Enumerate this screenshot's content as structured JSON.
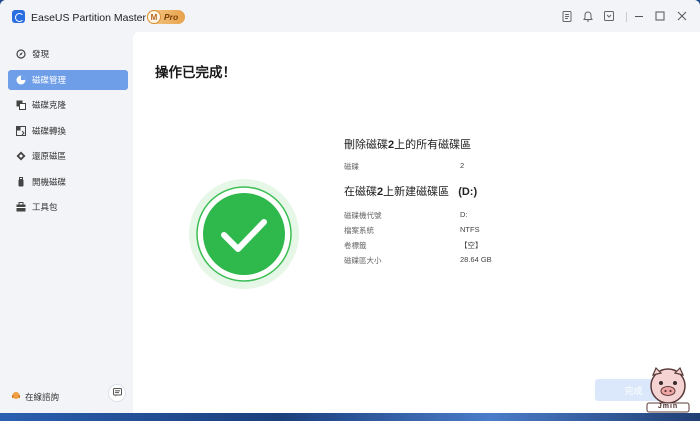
{
  "window": {
    "app_title": "EaseUS Partition Master 專業版",
    "badge_letter": "M",
    "badge_text": "Pro",
    "controls": [
      "notes-icon",
      "bell-icon",
      "dropdown-menu-icon",
      "minimize-icon",
      "maximize-icon",
      "close-icon"
    ]
  },
  "sidebar": {
    "items": [
      {
        "label": "發現",
        "icon": "discover-icon",
        "active": false
      },
      {
        "label": "磁碟管理",
        "icon": "disk-management-icon",
        "active": true
      },
      {
        "label": "磁碟克隆",
        "icon": "disk-clone-icon",
        "active": false
      },
      {
        "label": "磁碟轉換",
        "icon": "disk-convert-icon",
        "active": false
      },
      {
        "label": "還原磁區",
        "icon": "partition-recovery-icon",
        "active": false
      },
      {
        "label": "開機磁碟",
        "icon": "bootable-disk-icon",
        "active": false
      },
      {
        "label": "工具包",
        "icon": "toolkit-icon",
        "active": false
      }
    ],
    "help_label": "在線諮詢",
    "help_icon": "chat-support-icon",
    "feedback_icon": "feedback-icon"
  },
  "main": {
    "title": "操作已完成！",
    "success_icon": "checkmark-circle-icon",
    "operations": [
      {
        "title_prefix": "刪除磁碟",
        "title_bold": "2",
        "title_suffix": "上的所有磁碟區",
        "properties": [
          {
            "label": "磁碟",
            "value": "2"
          }
        ]
      },
      {
        "title_prefix": "在磁碟",
        "title_bold": "2",
        "title_suffix": "上新建磁碟區",
        "title_extra": "(D:)",
        "properties": [
          {
            "label": "磁碟機代號",
            "value": "D:"
          },
          {
            "label": "檔案系統",
            "value": "NTFS"
          },
          {
            "label": "卷標籤",
            "value": "【空】"
          },
          {
            "label": "磁碟區大小",
            "value": "28.64 GB"
          }
        ]
      }
    ],
    "finish_label": "完成"
  },
  "watermark": {
    "text": "Jmin",
    "icon": "pig-mascot-icon"
  },
  "colors": {
    "accent": "#6f9ee8",
    "success": "#2fb84c",
    "finish_button": "#dbe8fb"
  }
}
